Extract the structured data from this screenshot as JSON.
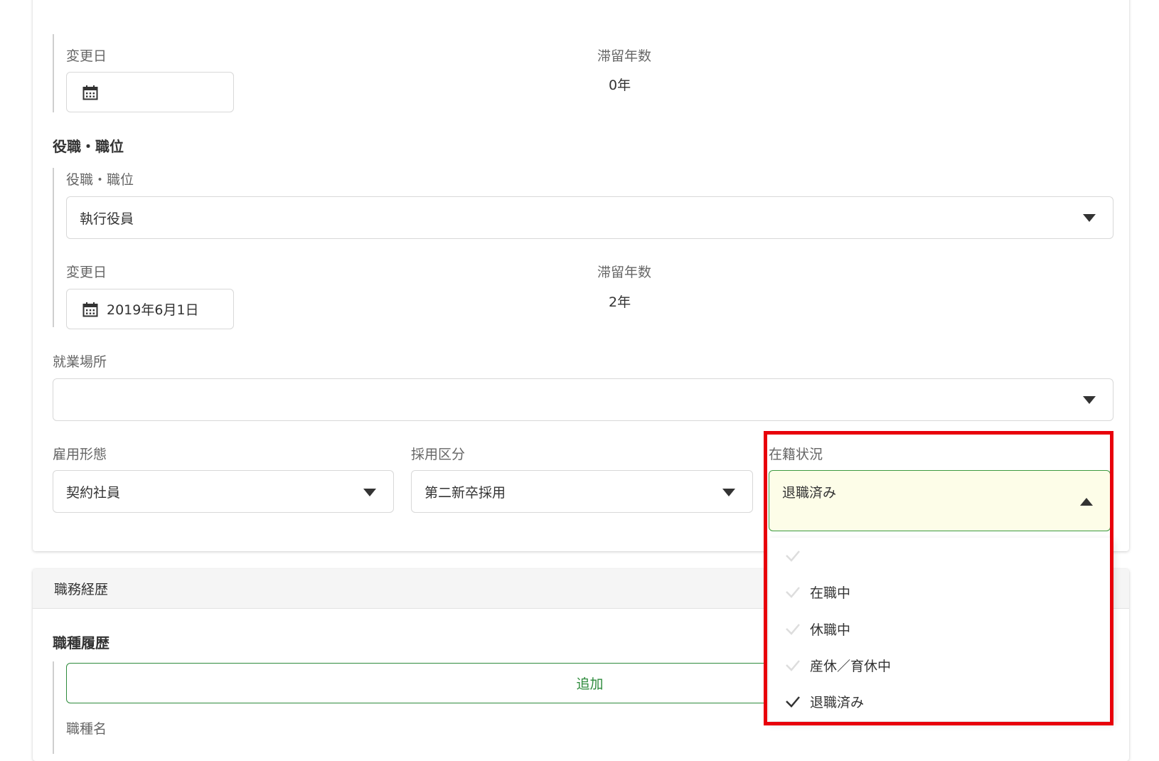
{
  "upper_section": {
    "change_date_label": "変更日",
    "tenure_label": "滞留年数",
    "tenure_value": "0年"
  },
  "position": {
    "heading": "役職・職位",
    "field_label": "役職・職位",
    "selected": "執行役員",
    "change_date_label": "変更日",
    "change_date_value": "2019年6月1日",
    "tenure_label": "滞留年数",
    "tenure_value": "2年"
  },
  "workplace": {
    "label": "就業場所",
    "selected": ""
  },
  "employment_type": {
    "label": "雇用形態",
    "selected": "契約社員"
  },
  "hiring_category": {
    "label": "採用区分",
    "selected": "第二新卒採用"
  },
  "enrollment_status": {
    "label": "在籍状況",
    "selected": "退職済み",
    "options": [
      {
        "label": "",
        "checked": false
      },
      {
        "label": "在職中",
        "checked": false
      },
      {
        "label": "休職中",
        "checked": false
      },
      {
        "label": "産休／育休中",
        "checked": false
      },
      {
        "label": "退職済み",
        "checked": true
      }
    ]
  },
  "career": {
    "section_title": "職務経歴",
    "job_history_heading": "職種履歴",
    "add_label": "追加",
    "job_name_label": "職種名"
  },
  "colors": {
    "accent_green": "#2e8b3c",
    "selected_bg": "#fdfde8",
    "highlight_red": "#e8000b"
  }
}
